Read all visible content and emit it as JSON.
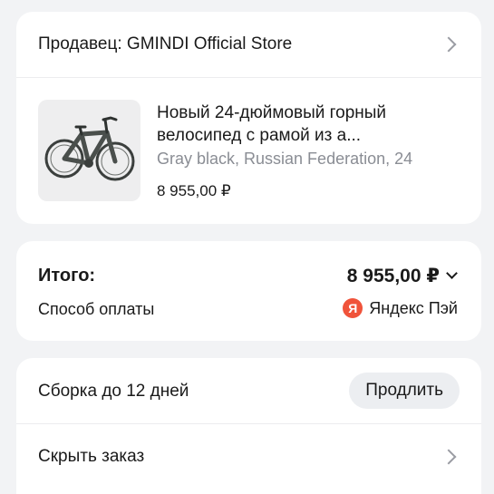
{
  "seller": {
    "label": "Продавец: GMINDI Official Store"
  },
  "product": {
    "title": "Новый 24-дюймовый горный велосипед с рамой из а...",
    "variant": "Gray black, Russian Federation, 24",
    "price": "8 955,00 ₽"
  },
  "summary": {
    "total_label": "Итого:",
    "total_value": "8 955,00 ₽",
    "payment_label": "Способ оплаты",
    "payment_method": "Яндекс Пэй",
    "payment_icon_letter": "Я"
  },
  "actions": {
    "assembly_label": "Сборка до 12 дней",
    "extend_button": "Продлить",
    "hide_order": "Скрыть заказ"
  },
  "colors": {
    "background": "#f2f3f5",
    "card": "#ffffff",
    "muted_text": "#8a8d94",
    "yandex_pay": "#f0533a"
  }
}
